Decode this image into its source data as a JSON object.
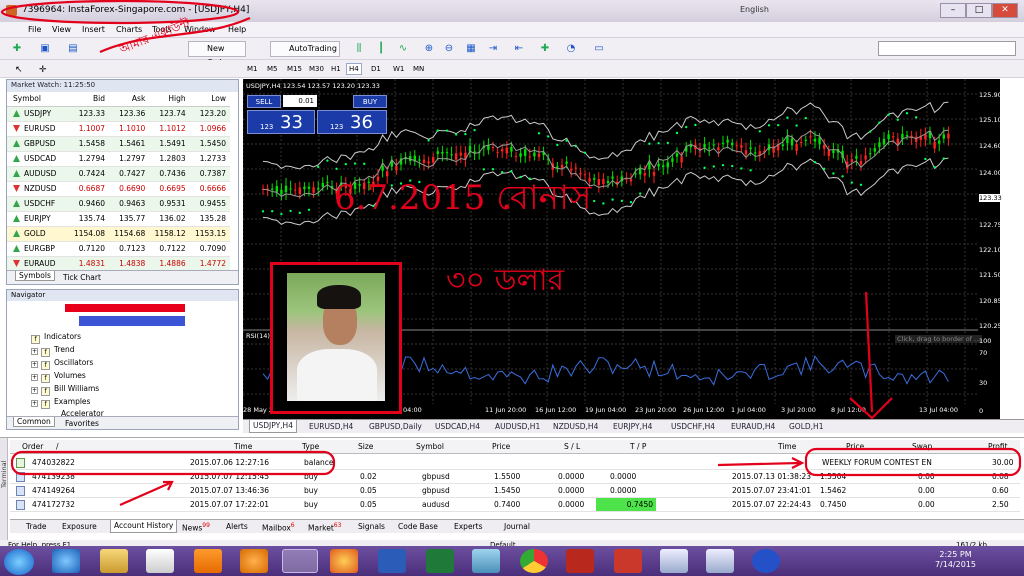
{
  "window": {
    "title": "7396964: InstaForex-Singapore.com - [USDJPY,H4]",
    "language": "English"
  },
  "menu": [
    "File",
    "View",
    "Insert",
    "Charts",
    "Tools",
    "Window",
    "Help"
  ],
  "toolbar": {
    "new_order": "New Order",
    "autotrading": "AutoTrading"
  },
  "timeframes": [
    "M1",
    "M5",
    "M15",
    "M30",
    "H1",
    "H4",
    "D1",
    "W1",
    "MN"
  ],
  "timeframe_selected": "H4",
  "market_watch": {
    "header": "Market Watch: 11:25:50",
    "columns": [
      "Symbol",
      "Bid",
      "Ask",
      "High",
      "Low"
    ],
    "rows": [
      {
        "symbol": "USDJPY",
        "bid": "123.33",
        "ask": "123.36",
        "high": "123.74",
        "low": "123.20",
        "dir": "up"
      },
      {
        "symbol": "EURUSD",
        "bid": "1.1007",
        "ask": "1.1010",
        "high": "1.1012",
        "low": "1.0966",
        "dir": "down"
      },
      {
        "symbol": "GBPUSD",
        "bid": "1.5458",
        "ask": "1.5461",
        "high": "1.5491",
        "low": "1.5450",
        "dir": "up"
      },
      {
        "symbol": "USDCAD",
        "bid": "1.2794",
        "ask": "1.2797",
        "high": "1.2803",
        "low": "1.2733",
        "dir": "up"
      },
      {
        "symbol": "AUDUSD",
        "bid": "0.7424",
        "ask": "0.7427",
        "high": "0.7436",
        "low": "0.7387",
        "dir": "up"
      },
      {
        "symbol": "NZDUSD",
        "bid": "0.6687",
        "ask": "0.6690",
        "high": "0.6695",
        "low": "0.6666",
        "dir": "down"
      },
      {
        "symbol": "USDCHF",
        "bid": "0.9460",
        "ask": "0.9463",
        "high": "0.9531",
        "low": "0.9455",
        "dir": "up"
      },
      {
        "symbol": "EURJPY",
        "bid": "135.74",
        "ask": "135.77",
        "high": "136.02",
        "low": "135.28",
        "dir": "up"
      },
      {
        "symbol": "GOLD",
        "bid": "1154.08",
        "ask": "1154.68",
        "high": "1158.12",
        "low": "1153.15",
        "dir": "gold"
      },
      {
        "symbol": "EURGBP",
        "bid": "0.7120",
        "ask": "0.7123",
        "high": "0.7122",
        "low": "0.7090",
        "dir": "up"
      },
      {
        "symbol": "EURAUD",
        "bid": "1.4831",
        "ask": "1.4838",
        "high": "1.4886",
        "low": "1.4772",
        "dir": "down"
      }
    ],
    "tabs": [
      "Symbols",
      "Tick Chart"
    ]
  },
  "navigator": {
    "header": "Navigator",
    "items": [
      "Indicators",
      "Trend",
      "Oscillators",
      "Volumes",
      "Bill Williams",
      "Examples",
      "Accelerator"
    ],
    "tabs": [
      "Common",
      "Favorites"
    ]
  },
  "chart": {
    "header": "USDJPY,H4  123.54 123.57 123.20 123.33",
    "sell": {
      "label": "SELL",
      "price_small": "123",
      "price_big": "33"
    },
    "buy": {
      "label": "BUY",
      "price_small": "123",
      "price_big": "36"
    },
    "lot": "0.01",
    "rsi_label": "RSI(14) 6",
    "rsi_hint": "Click, drag to border of ...",
    "price_axis": [
      "125.90",
      "125.10",
      "124.60",
      "124.00",
      "123.33",
      "122.75",
      "122.10",
      "121.50",
      "120.85",
      "120.25",
      "70",
      "30",
      "0",
      "100"
    ],
    "time_axis": [
      "28 May 20",
      "04:00",
      "11 Jun 20:00",
      "16 Jun 12:00",
      "19 Jun 04:00",
      "23 Jun 20:00",
      "26 Jun 12:00",
      "1 Jul 04:00",
      "3 Jul 20:00",
      "8 Jul 12:00",
      "13 Jul 04:00"
    ],
    "tabs": [
      "USDJPY,H4",
      "EURUSD,H4",
      "GBPUSD,Daily",
      "USDCAD,H4",
      "AUDUSD,H1",
      "NZDUSD,H4",
      "EURJPY,H4",
      "USDCHF,H4",
      "EURAUD,H4",
      "GOLD,H1"
    ]
  },
  "annotations": {
    "handwriting_top": "আমার একাউন্ট",
    "big_date": "6.7.2015 বোনাস",
    "big_amount": "৩০ ডলার"
  },
  "terminal": {
    "side_label": "Terminal",
    "columns": [
      "Order",
      "/",
      "Time",
      "Type",
      "Size",
      "Symbol",
      "Price",
      "S / L",
      "T / P",
      "Time",
      "Price",
      "Swap",
      "Profit"
    ],
    "rows": [
      {
        "order": "474032822",
        "time": "2015.07.06 12:27:16",
        "type": "balance",
        "size": "",
        "symbol": "",
        "price": "",
        "sl": "",
        "tp": "",
        "ctime": "",
        "cprice": "WEEKLY FORUM CONTEST EN",
        "swap": "",
        "profit": "30.00",
        "kind": "bal"
      },
      {
        "order": "474139238",
        "time": "2015.07.07 12:15:45",
        "type": "buy",
        "size": "0.02",
        "symbol": "gbpusd",
        "price": "1.5500",
        "sl": "0.0000",
        "tp": "0.0000",
        "ctime": "2015.07.13 01:38:23",
        "cprice": "1.5504",
        "swap": "0.00",
        "profit": "0.08",
        "kind": "buy"
      },
      {
        "order": "474149264",
        "time": "2015.07.07 13:46:36",
        "type": "buy",
        "size": "0.05",
        "symbol": "gbpusd",
        "price": "1.5450",
        "sl": "0.0000",
        "tp": "0.0000",
        "ctime": "2015.07.07 23:41:01",
        "cprice": "1.5462",
        "swap": "0.00",
        "profit": "0.60",
        "kind": "buy"
      },
      {
        "order": "474172732",
        "time": "2015.07.07 17:22:01",
        "type": "buy",
        "size": "0.05",
        "symbol": "audusd",
        "price": "0.7400",
        "sl": "0.0000",
        "tp": "0.7450",
        "ctime": "2015.07.07 22:24:43",
        "cprice": "0.7450",
        "swap": "0.00",
        "profit": "2.50",
        "kind": "buy"
      }
    ],
    "tabs": [
      {
        "label": "Trade",
        "badge": ""
      },
      {
        "label": "Exposure",
        "badge": ""
      },
      {
        "label": "Account History",
        "badge": ""
      },
      {
        "label": "News",
        "badge": "99"
      },
      {
        "label": "Alerts",
        "badge": ""
      },
      {
        "label": "Mailbox",
        "badge": "6"
      },
      {
        "label": "Market",
        "badge": "63"
      },
      {
        "label": "Signals",
        "badge": ""
      },
      {
        "label": "Code Base",
        "badge": ""
      },
      {
        "label": "Experts",
        "badge": ""
      },
      {
        "label": "Journal",
        "badge": ""
      }
    ]
  },
  "status": {
    "help": "For Help, press F1",
    "profile": "Default",
    "traffic": "161/2 kb"
  },
  "taskbar": {
    "time": "2:25 PM",
    "date": "7/14/2015"
  },
  "colors": {
    "chart_bg": "#000000",
    "bull": "#00e000",
    "bear": "#ff2020",
    "annotation": "#e3001b",
    "tp_hit": "#4ee34a"
  }
}
